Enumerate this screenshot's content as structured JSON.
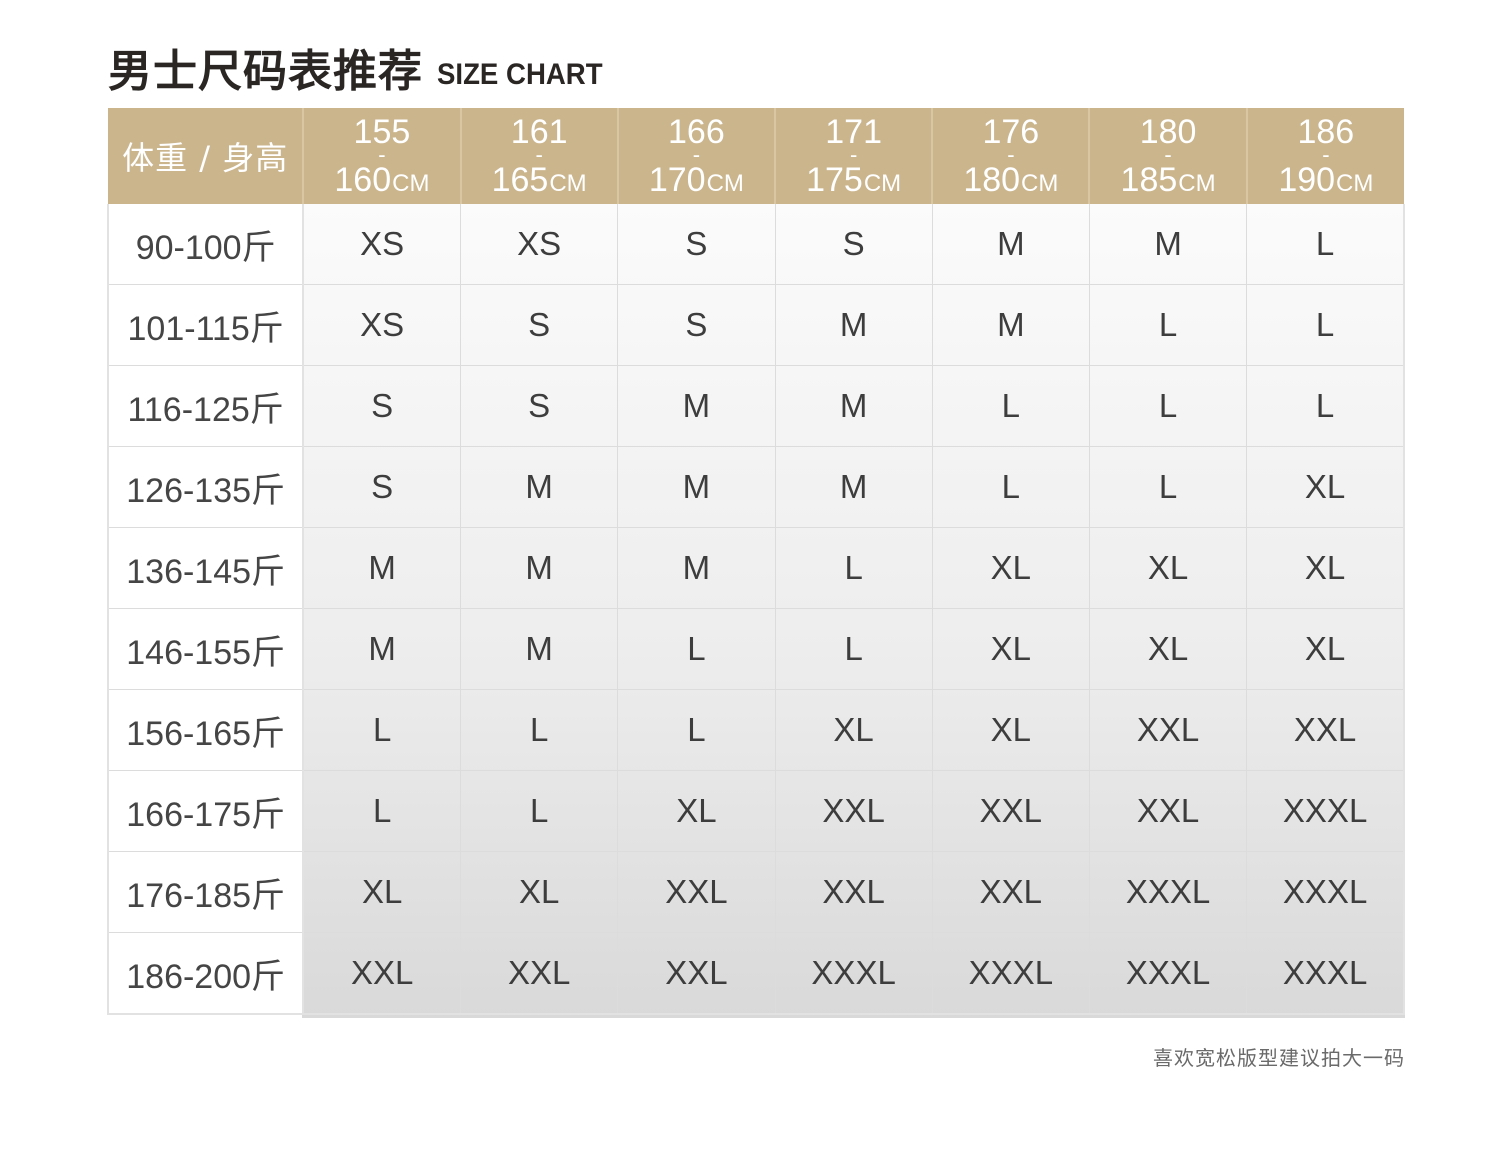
{
  "title": {
    "cn": "男士尺码表推荐",
    "en": "SIZE CHART"
  },
  "header": {
    "corner": "体重 / 身高",
    "unit": "CM",
    "height_ranges": [
      {
        "from": "155",
        "to": "160"
      },
      {
        "from": "161",
        "to": "165"
      },
      {
        "from": "166",
        "to": "170"
      },
      {
        "from": "171",
        "to": "175"
      },
      {
        "from": "176",
        "to": "180"
      },
      {
        "from": "180",
        "to": "185"
      },
      {
        "from": "186",
        "to": "190"
      }
    ]
  },
  "rows": [
    {
      "weight": "90-100斤",
      "sizes": [
        "XS",
        "XS",
        "S",
        "S",
        "M",
        "M",
        "L"
      ]
    },
    {
      "weight": "101-115斤",
      "sizes": [
        "XS",
        "S",
        "S",
        "M",
        "M",
        "L",
        "L"
      ]
    },
    {
      "weight": "116-125斤",
      "sizes": [
        "S",
        "S",
        "M",
        "M",
        "L",
        "L",
        "L"
      ]
    },
    {
      "weight": "126-135斤",
      "sizes": [
        "S",
        "M",
        "M",
        "M",
        "L",
        "L",
        "XL"
      ]
    },
    {
      "weight": "136-145斤",
      "sizes": [
        "M",
        "M",
        "M",
        "L",
        "XL",
        "XL",
        "XL"
      ]
    },
    {
      "weight": "146-155斤",
      "sizes": [
        "M",
        "M",
        "L",
        "L",
        "XL",
        "XL",
        "XL"
      ]
    },
    {
      "weight": "156-165斤",
      "sizes": [
        "L",
        "L",
        "L",
        "XL",
        "XL",
        "XXL",
        "XXL"
      ]
    },
    {
      "weight": "166-175斤",
      "sizes": [
        "L",
        "L",
        "XL",
        "XXL",
        "XXL",
        "XXL",
        "XXXL"
      ]
    },
    {
      "weight": "176-185斤",
      "sizes": [
        "XL",
        "XL",
        "XXL",
        "XXL",
        "XXL",
        "XXXL",
        "XXXL"
      ]
    },
    {
      "weight": "186-200斤",
      "sizes": [
        "XXL",
        "XXL",
        "XXL",
        "XXXL",
        "XXXL",
        "XXXL",
        "XXXL"
      ]
    }
  ],
  "footnote": "喜欢宽松版型建议拍大一码",
  "colors": {
    "header_bg": "#cbb58d",
    "header_text": "#ffffff",
    "title_text": "#2a2624",
    "cell_text": "#3d3d3d"
  }
}
